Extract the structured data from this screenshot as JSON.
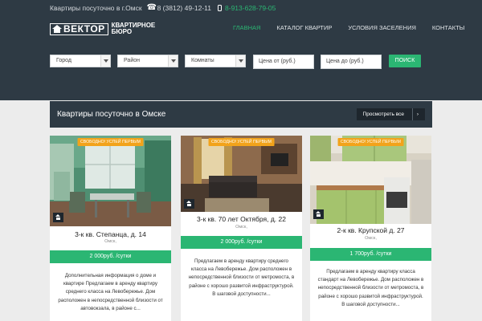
{
  "topbar": {
    "text": "Квартиры посуточно в г.Омск",
    "phone1": "8 (3812) 49-12-11",
    "phone2": "8-913-628-79-05"
  },
  "logo": {
    "word": "ВЕКТОР",
    "sub1": "КВАРТИРНОЕ",
    "sub2": "БЮРО"
  },
  "nav": {
    "items": [
      "ГЛАВНАЯ",
      "КАТАЛОГ КВАРТИР",
      "УСЛОВИЯ ЗАСЕЛЕНИЯ",
      "КОНТАКТЫ"
    ],
    "active_index": 0
  },
  "filters": {
    "city": "Город",
    "district": "Район",
    "rooms": "Комнаты",
    "price_from": "Цена от (руб.)",
    "price_to": "Цена до (руб.)",
    "search": "ПОИСК"
  },
  "section": {
    "title": "Квартиры посуточно в Омске",
    "view_all": "Просмотреть все",
    "view_all_icon": "›"
  },
  "cards": [
    {
      "badge": "СВОБОДНО! УСПЕЙ ПЕРВЫМ",
      "title": "3-к кв. Степанца, д. 14",
      "city": "Омск,",
      "price": "2 000руб. /сутки",
      "description": "Дополнительная информация о доме и квартире Предлагаем в аренду квартиру среднего класса на Левобережье. Дом расположен в непосредственной близости от автовокзала, в районе с..."
    },
    {
      "badge": "СВОБОДНО! УСПЕЙ ПЕРВЫМ",
      "title": "3-к кв. 70 лет Октября, д. 22",
      "city": "Омск,",
      "price": "2 000руб. /сутки",
      "description": "Предлагаем в аренду квартиру среднего класса на Левобережье. Дом расположен в непосредственной близости от метромоста, в районе с хорошо развитой инфраструктурой. В шаговой доступности..."
    },
    {
      "badge": "СВОБОДНО! УСПЕЙ ПЕРВЫМ",
      "title": "2-к кв. Крупской д. 27",
      "city": "Омск,",
      "price": "1 700руб. /сутки",
      "description": "Предлагаем в аренду квартиру класса стандарт на Левобережье. Дом расположен в непосредственной близости от метромоста, в районе с хорошо развитой инфраструктурой. В шаговой доступности..."
    }
  ],
  "colors": {
    "header_bg": "#2e3a44",
    "accent_green": "#2bb673",
    "badge_orange": "#f2a31b"
  }
}
